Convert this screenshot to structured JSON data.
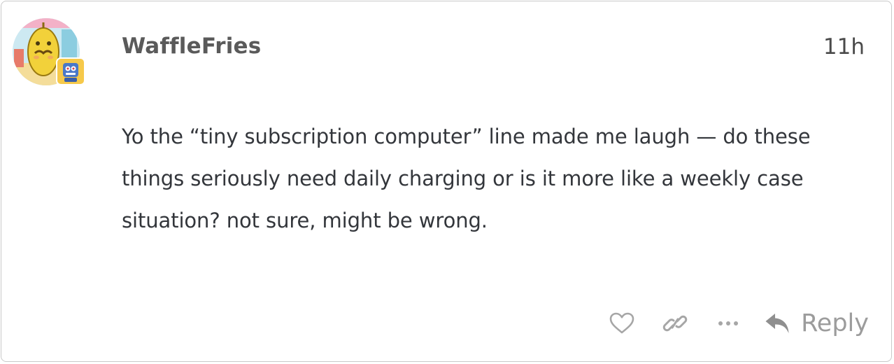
{
  "post": {
    "author": "WaffleFries",
    "time_ago": "11h",
    "body": "Yo the “tiny subscription computer” line made me laugh — do these things seriously need daily charging or is it more like a weekly case situation? not sure, might be wrong."
  },
  "actions": {
    "like_icon": "heart-icon",
    "link_icon": "link-icon",
    "more_icon": "ellipsis-icon",
    "reply_icon": "reply-arrow-icon",
    "reply_label": "Reply"
  },
  "colors": {
    "border": "#c9c9c9",
    "username": "#5a5a5a",
    "text": "#33363b",
    "muted_icon": "#a6a6a6",
    "flair_bg": "#f6c94a"
  }
}
